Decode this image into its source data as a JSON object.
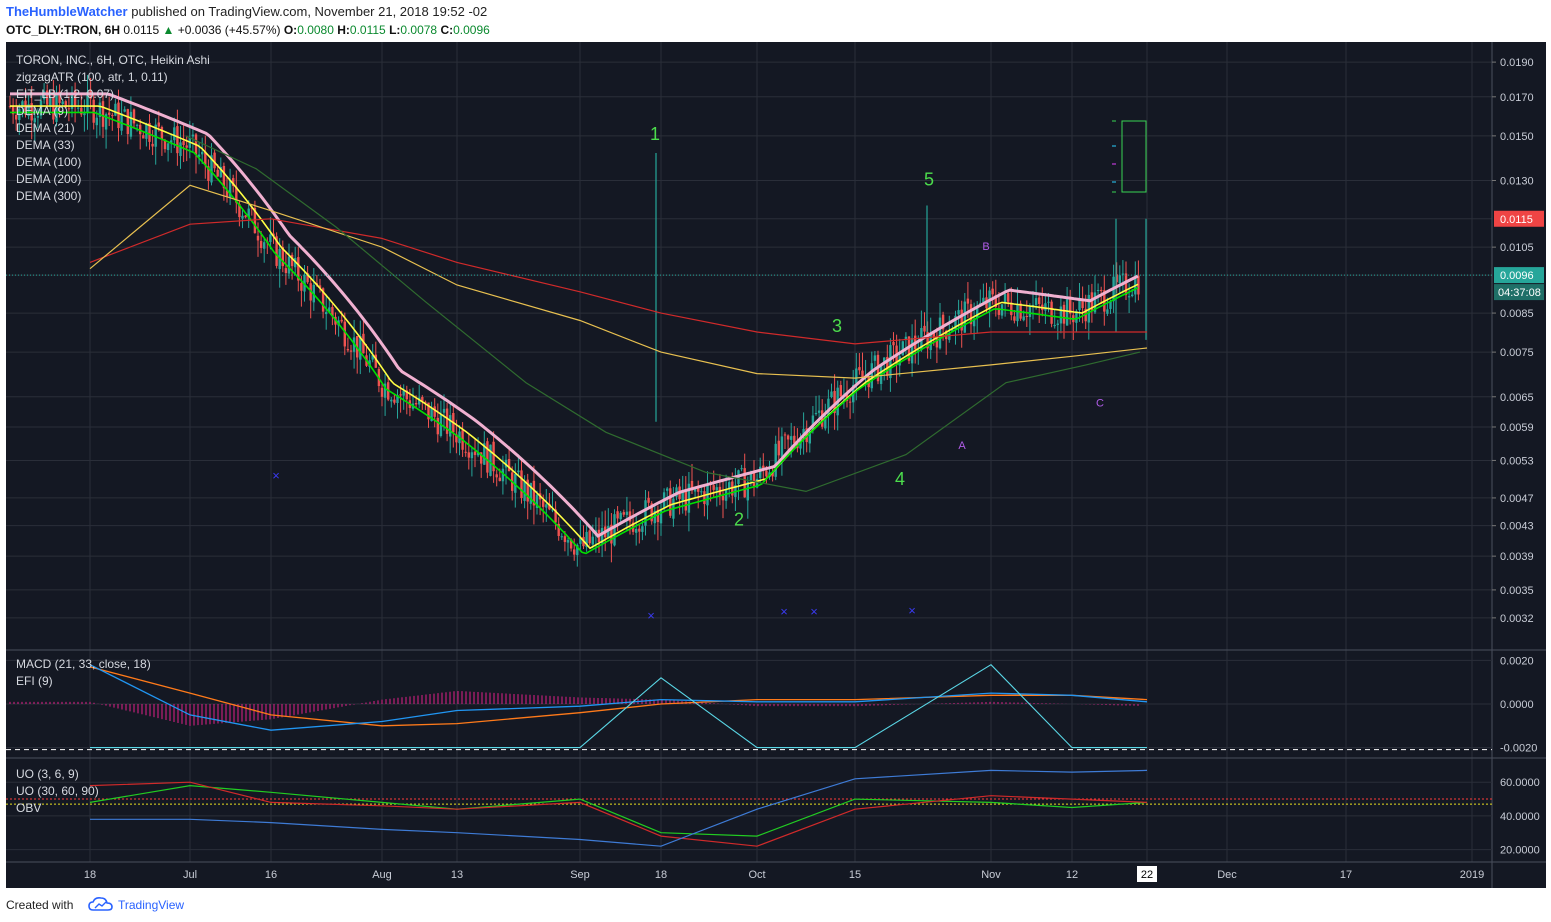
{
  "header": {
    "author": "TheHumbleWatcher",
    "published": "published on TradingView.com, November 21, 2018 19:52 -02",
    "symbol": "OTC_DLY:TRON, 6H",
    "last": "0.0115",
    "change": "+0.0036 (+45.57%)",
    "o_label": "O:",
    "o_value": "0.0080",
    "h_label": "H:",
    "h_value": "0.0115",
    "l_label": "L:",
    "l_value": "0.0078",
    "c_label": "C:",
    "c_value": "0.0096"
  },
  "footer": {
    "created": "Created with",
    "brand": "TradingView"
  },
  "colors": {
    "background": "#141823",
    "grid": "#2a2e39",
    "up": "#26a69a",
    "down": "#ef5350",
    "wave_label": "#4cdc4c",
    "abc_label": "#b05ce8",
    "dema_fast": "#00e000",
    "dema_mid": "#ffff44",
    "dema_slow": "#f0b0d0",
    "dema_100": "#2f6b2f",
    "dema_200": "#d02a2a",
    "dema_300": "#e8c050",
    "macd": "#2196f3",
    "signal": "#ff7a1a",
    "efi": "#5ad7e6",
    "uo_fast": "#22cc22",
    "uo_slow": "#d02a2a",
    "obv": "#3e7bd6",
    "last_price_tag": "#ef4444",
    "close_tag": "#26a69a"
  },
  "legend": [
    "TORON, INC., 6H, OTC, Heikin Ashi",
    "zigzagATR (100, atr, 1, 0.11)",
    "EIT_LB (1.2, 0.07)",
    "DEMA (9)",
    "DEMA (21)",
    "DEMA (33)",
    "DEMA (100)",
    "DEMA (200)",
    "DEMA (300)"
  ],
  "macd_legend": [
    "MACD (21, 33, close, 18)",
    "EFI (9)"
  ],
  "uo_legend": [
    "UO (3, 6, 9)",
    "UO (30, 60, 90)",
    "OBV"
  ],
  "tags": {
    "last_price": "0.0115",
    "close_price": "0.0096",
    "countdown": "04:37:08"
  },
  "chart_data": [
    {
      "type": "line",
      "title": "TORON, INC., 6H, OTC, Heikin Ashi",
      "y_scale": "log",
      "ylim": [
        0.003,
        0.0195
      ],
      "y_ticks": [
        "0.0190",
        "0.0170",
        "0.0150",
        "0.0130",
        "0.0115",
        "0.0105",
        "0.0096",
        "0.0085",
        "0.0075",
        "0.0065",
        "0.0059",
        "0.0053",
        "0.0047",
        "0.0043",
        "0.0039",
        "0.0035",
        "0.0032"
      ],
      "x_ticks": [
        "18",
        "Jul",
        "16",
        "Aug",
        "13",
        "Sep",
        "18",
        "Oct",
        "15",
        "Nov",
        "12",
        "22",
        "Dec",
        "17",
        "2019"
      ],
      "series": [
        {
          "name": "Heikin Ashi close (approx.)",
          "x": [
            "18",
            "Jul",
            "16",
            "Aug",
            "13",
            "Sep",
            "18",
            "Oct",
            "15",
            "Nov",
            "12",
            "22"
          ],
          "values": [
            0.0165,
            0.0145,
            0.0105,
            0.0068,
            0.0058,
            0.004,
            0.0046,
            0.005,
            0.0068,
            0.0088,
            0.0085,
            0.0096
          ]
        },
        {
          "name": "DEMA (200)",
          "x": [
            "18",
            "Jul",
            "16",
            "Aug",
            "13",
            "Sep",
            "18",
            "Oct",
            "15",
            "Nov",
            "12",
            "22"
          ],
          "values": [
            0.01,
            0.0113,
            0.0115,
            0.0108,
            0.01,
            0.0091,
            0.0085,
            0.008,
            0.0077,
            0.008,
            0.008,
            0.008
          ]
        },
        {
          "name": "DEMA (300)",
          "x": [
            "18",
            "Jul",
            "16",
            "Aug",
            "13",
            "Sep",
            "18",
            "Oct",
            "15",
            "Nov",
            "12",
            "22"
          ],
          "values": [
            0.0098,
            0.0128,
            0.0118,
            0.0105,
            0.0093,
            0.0083,
            0.0075,
            0.007,
            0.0069,
            0.0072,
            0.0074,
            0.0076
          ]
        }
      ],
      "annotations": [
        {
          "label": "1",
          "x": "18",
          "y": 0.0148
        },
        {
          "label": "2",
          "x": "Oct",
          "y": 0.0043
        },
        {
          "label": "3",
          "x": "15",
          "y": 0.008
        },
        {
          "label": "4",
          "x": "15",
          "y": 0.0049
        },
        {
          "label": "5",
          "x": "Nov",
          "y": 0.0128
        },
        {
          "label": "A",
          "x": "Nov",
          "y": 0.0055
        },
        {
          "label": "B",
          "x": "Nov",
          "y": 0.0104
        },
        {
          "label": "C",
          "x": "12",
          "y": 0.0063
        }
      ],
      "grid": true
    },
    {
      "type": "line",
      "title": "MACD (21, 33, close, 18)",
      "ylim": [
        -0.0022,
        0.0022
      ],
      "y_ticks": [
        "0.0020",
        "0.0000",
        "-0.0020"
      ],
      "series": [
        {
          "name": "MACD",
          "values": [
            0.0018,
            -0.0005,
            -0.0012,
            -0.0008,
            -0.0003,
            -0.0001,
            0.0002,
            0.0001,
            0.0001,
            0.0005,
            0.0004,
            0.0001
          ]
        },
        {
          "name": "Signal",
          "values": [
            0.0017,
            0.0005,
            -0.0005,
            -0.001,
            -0.0009,
            -0.0004,
            0.0,
            0.0002,
            0.0002,
            0.0004,
            0.0004,
            0.0002
          ]
        },
        {
          "name": "EFI (9)",
          "values": [
            -0.002,
            -0.002,
            -0.002,
            -0.002,
            -0.002,
            -0.002,
            0.0012,
            -0.002,
            -0.002,
            0.0018,
            -0.002,
            -0.002
          ]
        }
      ]
    },
    {
      "type": "line",
      "title": "UO (3, 6, 9)",
      "ylim": [
        15,
        72
      ],
      "y_ticks": [
        "60.0000",
        "40.0000",
        "20.0000"
      ],
      "series": [
        {
          "name": "UO (3, 6, 9)",
          "values": [
            48,
            58,
            54,
            48,
            44,
            50,
            30,
            28,
            50,
            48,
            45,
            48
          ]
        },
        {
          "name": "UO (30, 60, 90)",
          "values": [
            58,
            60,
            48,
            46,
            44,
            48,
            28,
            22,
            44,
            52,
            50,
            48
          ]
        },
        {
          "name": "OBV",
          "values": [
            38,
            38,
            36,
            32,
            30,
            26,
            22,
            44,
            62,
            67,
            66,
            67
          ]
        }
      ]
    }
  ]
}
